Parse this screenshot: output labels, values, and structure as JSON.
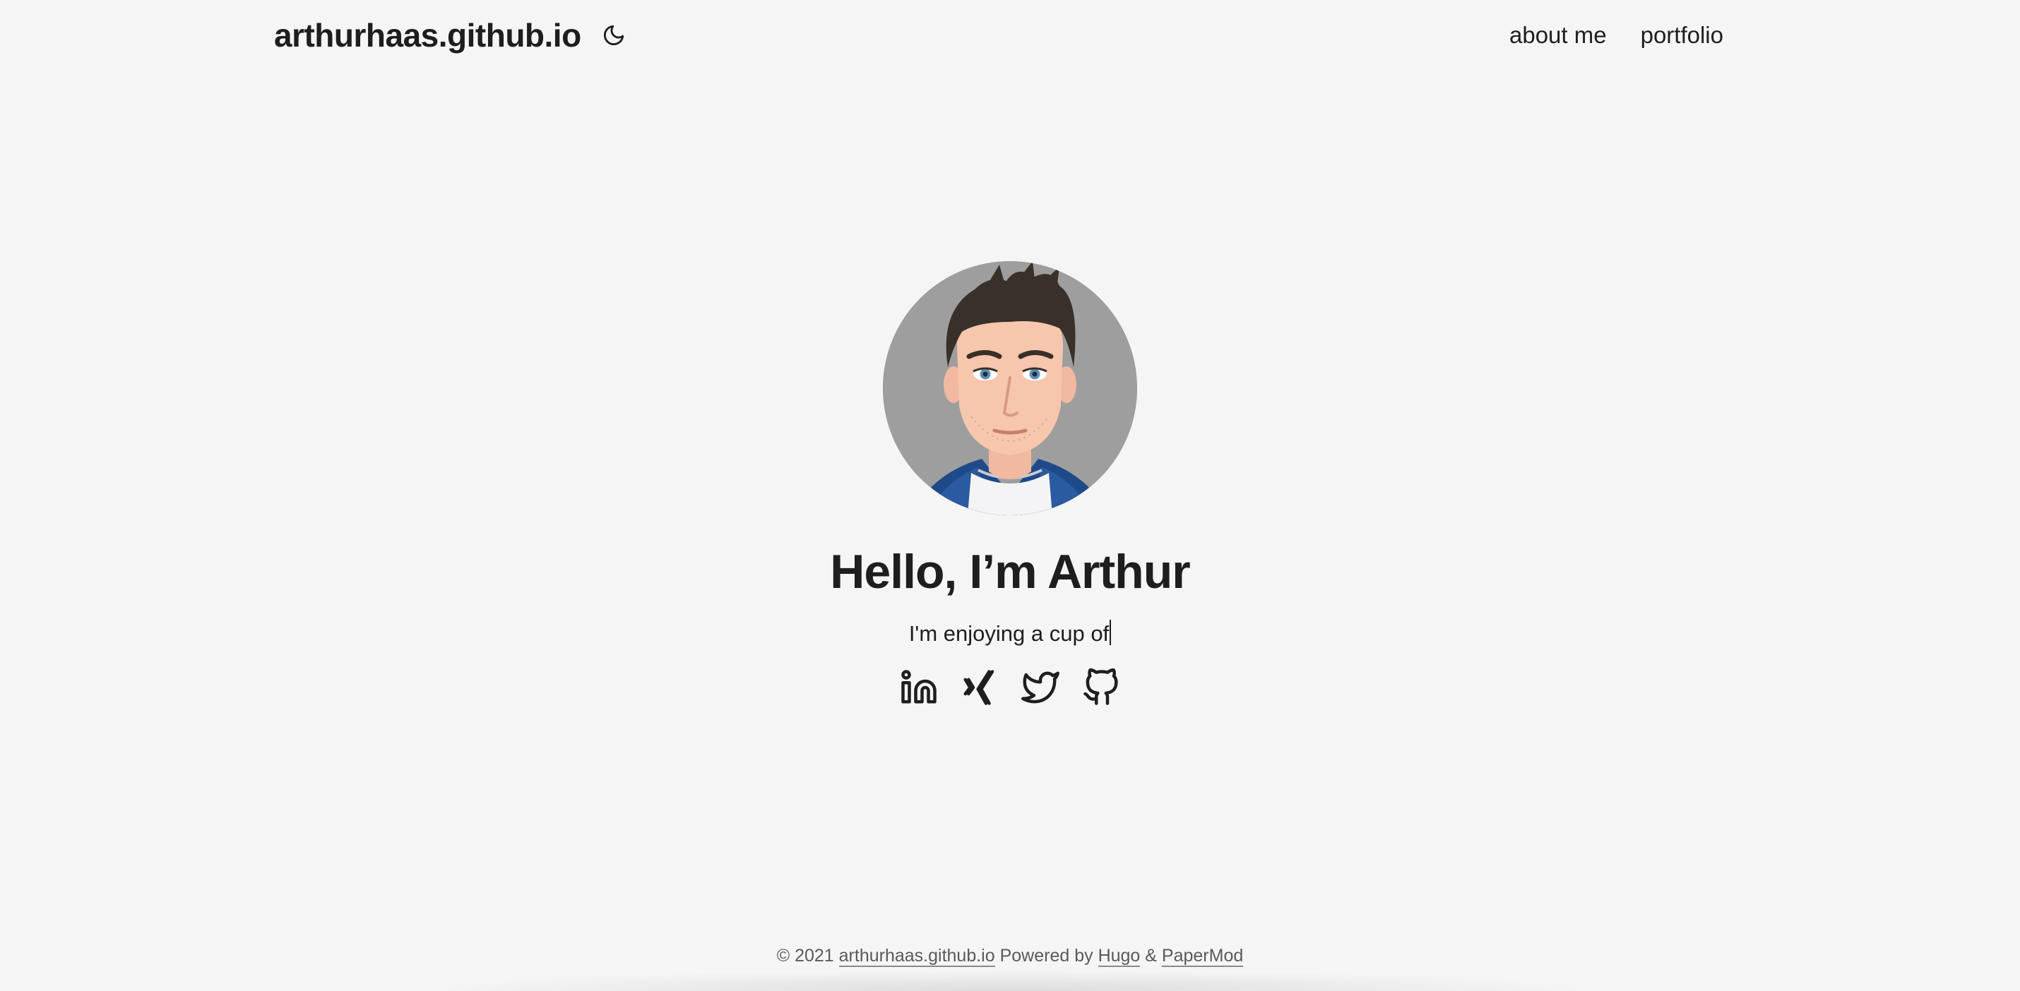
{
  "header": {
    "site_title": "arthurhaas.github.io",
    "theme_toggle_icon": "moon-icon",
    "nav": [
      {
        "label": "about me"
      },
      {
        "label": "portfolio"
      }
    ]
  },
  "profile": {
    "avatar_icon": "avatar-illustration",
    "title": "Hello, I’m Arthur",
    "subtitle": "I'm enjoying a cup of",
    "socials": [
      {
        "icon": "linkedin-icon"
      },
      {
        "icon": "xing-icon"
      },
      {
        "icon": "twitter-icon"
      },
      {
        "icon": "github-icon"
      }
    ]
  },
  "footer": {
    "copyright": "© 2021",
    "site_link": "arthurhaas.github.io",
    "powered_by": "Powered by",
    "hugo": "Hugo",
    "amp": "&",
    "papermod": "PaperMod"
  },
  "colors": {
    "background": "#f5f5f5",
    "text": "#1e1e1e",
    "footer_text": "#5a5a5a",
    "avatar_bg": "#9e9e9e"
  }
}
